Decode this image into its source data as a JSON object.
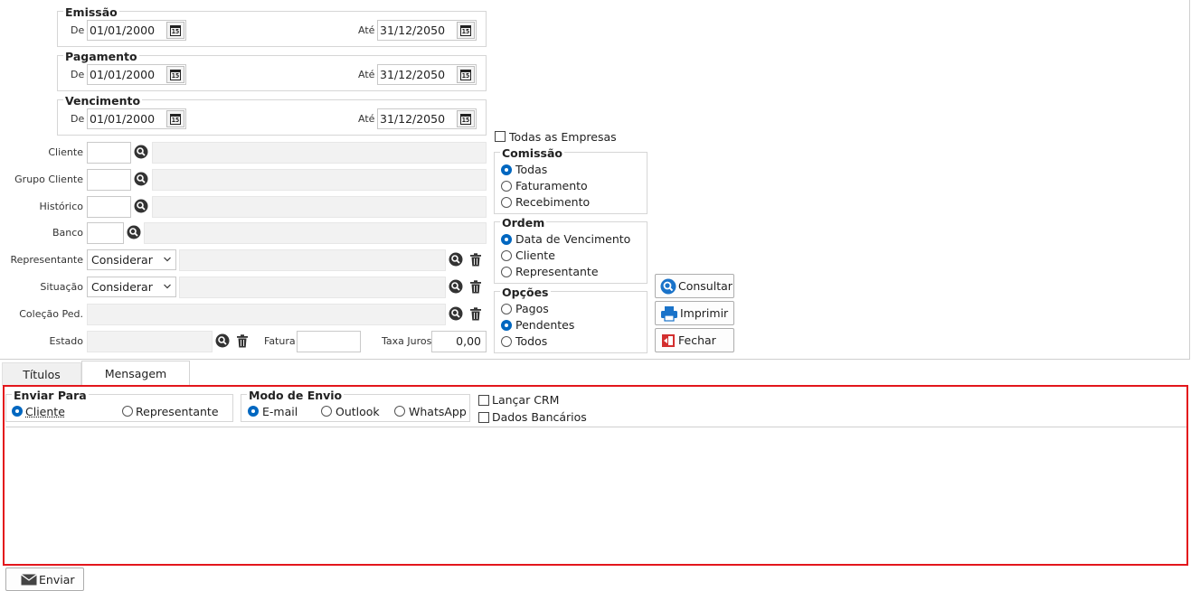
{
  "filters": {
    "emissao": {
      "title": "Emissão",
      "de_label": "De",
      "ate_label": "Até",
      "de": "01/01/2000",
      "ate": "31/12/2050"
    },
    "pagamento": {
      "title": "Pagamento",
      "de_label": "De",
      "ate_label": "Até",
      "de": "01/01/2000",
      "ate": "31/12/2050"
    },
    "vencimento": {
      "title": "Vencimento",
      "de_label": "De",
      "ate_label": "Até",
      "de": "01/01/2000",
      "ate": "31/12/2050"
    },
    "calendar_icon_text": "15"
  },
  "fields": {
    "cliente": "Cliente",
    "grupo_cliente": "Grupo Cliente",
    "historico": "Histórico",
    "banco": "Banco",
    "representante": "Representante",
    "representante_value": "Considerar",
    "situacao": "Situação",
    "situacao_value": "Considerar",
    "colecao": "Coleção Ped.",
    "estado": "Estado",
    "fatura": "Fatura",
    "taxa_juros": "Taxa Juros",
    "taxa_juros_value": "0,00"
  },
  "options": {
    "todas_empresas": "Todas as Empresas",
    "comissao": {
      "title": "Comissão",
      "items": [
        "Todas",
        "Faturamento",
        "Recebimento"
      ],
      "selected": 0
    },
    "ordem": {
      "title": "Ordem",
      "items": [
        "Data de Vencimento",
        "Cliente",
        "Representante"
      ],
      "selected": 0
    },
    "opcoes": {
      "title": "Opções",
      "items": [
        "Pagos",
        "Pendentes",
        "Todos"
      ],
      "selected": 1
    }
  },
  "buttons": {
    "consultar": "Consultar",
    "imprimir": "Imprimir",
    "fechar": "Fechar",
    "enviar": "Enviar"
  },
  "tabs": {
    "titulos": "Títulos",
    "mensagem": "Mensagem"
  },
  "message": {
    "enviar_para": {
      "title": "Enviar Para",
      "items": [
        "Cliente",
        "Representante"
      ],
      "selected": 0
    },
    "modo_envio": {
      "title": "Modo de Envio",
      "items": [
        "E-mail",
        "Outlook",
        "WhatsApp"
      ],
      "selected": 0
    },
    "lancar_crm": "Lançar CRM",
    "dados_bancarios": "Dados Bancários"
  },
  "colors": {
    "accent": "#0067c0",
    "highlight": "#e3161c"
  }
}
